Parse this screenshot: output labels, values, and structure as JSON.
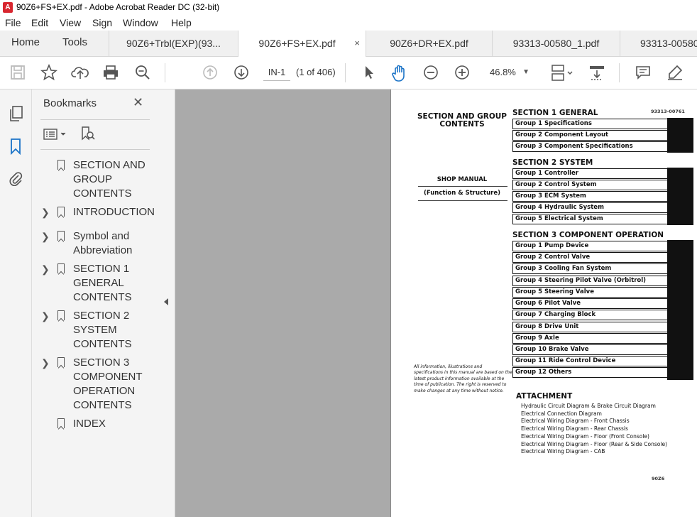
{
  "window": {
    "title": "90Z6+FS+EX.pdf - Adobe Acrobat Reader DC (32-bit)"
  },
  "menu": [
    "File",
    "Edit",
    "View",
    "Sign",
    "Window",
    "Help"
  ],
  "nav": {
    "home": "Home",
    "tools": "Tools"
  },
  "tabs": [
    {
      "label": "90Z6+Trbl(EXP)(93..."
    },
    {
      "label": "90Z6+FS+EX.pdf",
      "close": "×"
    },
    {
      "label": "90Z6+DR+EX.pdf"
    },
    {
      "label": "93313-00580_1.pdf"
    },
    {
      "label": "93313-00580"
    }
  ],
  "toolbar": {
    "page_input": "IN-1",
    "page_count": "(1 of 406)",
    "zoom": "46.8%"
  },
  "bookmarks": {
    "title": "Bookmarks",
    "close": "✕",
    "items": [
      {
        "label": "SECTION AND GROUP CONTENTS",
        "lines": [
          "SECTION AND",
          "GROUP",
          "CONTENTS"
        ]
      },
      {
        "label": "INTRODUCTION",
        "lines": [
          "INTRODUCTION"
        ]
      },
      {
        "label": "Symbol and Abbreviation",
        "lines": [
          "Symbol and",
          "Abbreviation"
        ]
      },
      {
        "label": "SECTION 1 GENERAL CONTENTS",
        "lines": [
          "SECTION 1",
          "GENERAL",
          "CONTENTS"
        ]
      },
      {
        "label": "SECTION 2 SYSTEM CONTENTS",
        "lines": [
          "SECTION 2",
          "SYSTEM",
          "CONTENTS"
        ]
      },
      {
        "label": "SECTION 3 COMPONENT OPERATION CONTENTS",
        "lines": [
          "SECTION 3",
          "COMPONENT",
          "OPERATION",
          "CONTENTS"
        ]
      },
      {
        "label": "INDEX",
        "lines": [
          "INDEX"
        ]
      }
    ]
  },
  "document": {
    "left_title": [
      "SECTION AND GROUP",
      "CONTENTS"
    ],
    "shop_manual": "SHOP MANUAL",
    "function_structure": "(Function & Structure)",
    "doc_number": "93313-00761",
    "disclaimer": [
      "All information, illustrations and",
      "specifications in this manual are based on the",
      "latest product information available at the",
      "time of publication. The right is reserved to",
      "make changes at any time without notice."
    ],
    "sections": [
      {
        "title": "SECTION 1 GENERAL",
        "groups": [
          "Group 1  Specifications",
          "Group 2  Component Layout",
          "Group 3  Component Specifications"
        ]
      },
      {
        "title": "SECTION 2 SYSTEM",
        "groups": [
          "Group 1  Controller",
          "Group 2  Control System",
          "Group 3  ECM System",
          "Group 4  Hydraulic System",
          "Group 5  Electrical System"
        ]
      },
      {
        "title": "SECTION 3 COMPONENT OPERATION",
        "groups": [
          "Group 1  Pump Device",
          "Group 2  Control Valve",
          "Group 3  Cooling Fan System",
          "Group 4  Steering Pilot Valve (Orbitrol)",
          "Group 5  Steering Valve",
          "Group 6  Pilot Valve",
          "Group 7  Charging Block",
          "Group 8  Drive Unit",
          "Group 9  Axle",
          "Group 10  Brake Valve",
          "Group 11  Ride Control Device",
          "Group 12  Others"
        ]
      }
    ],
    "attachment": {
      "title": "ATTACHMENT",
      "items": [
        "Hydraulic Circuit Diagram & Brake Circuit Diagram",
        "Electrical Connection Diagram",
        "Electrical Wiring Diagram - Front Chassis",
        "Electrical Wiring Diagram - Rear Chassis",
        "Electrical Wiring Diagram - Floor (Front Console)",
        "Electrical Wiring Diagram - Floor (Rear & Side Console)",
        "Electrical Wiring Diagram - CAB"
      ]
    },
    "footer_code": "90Z6"
  }
}
